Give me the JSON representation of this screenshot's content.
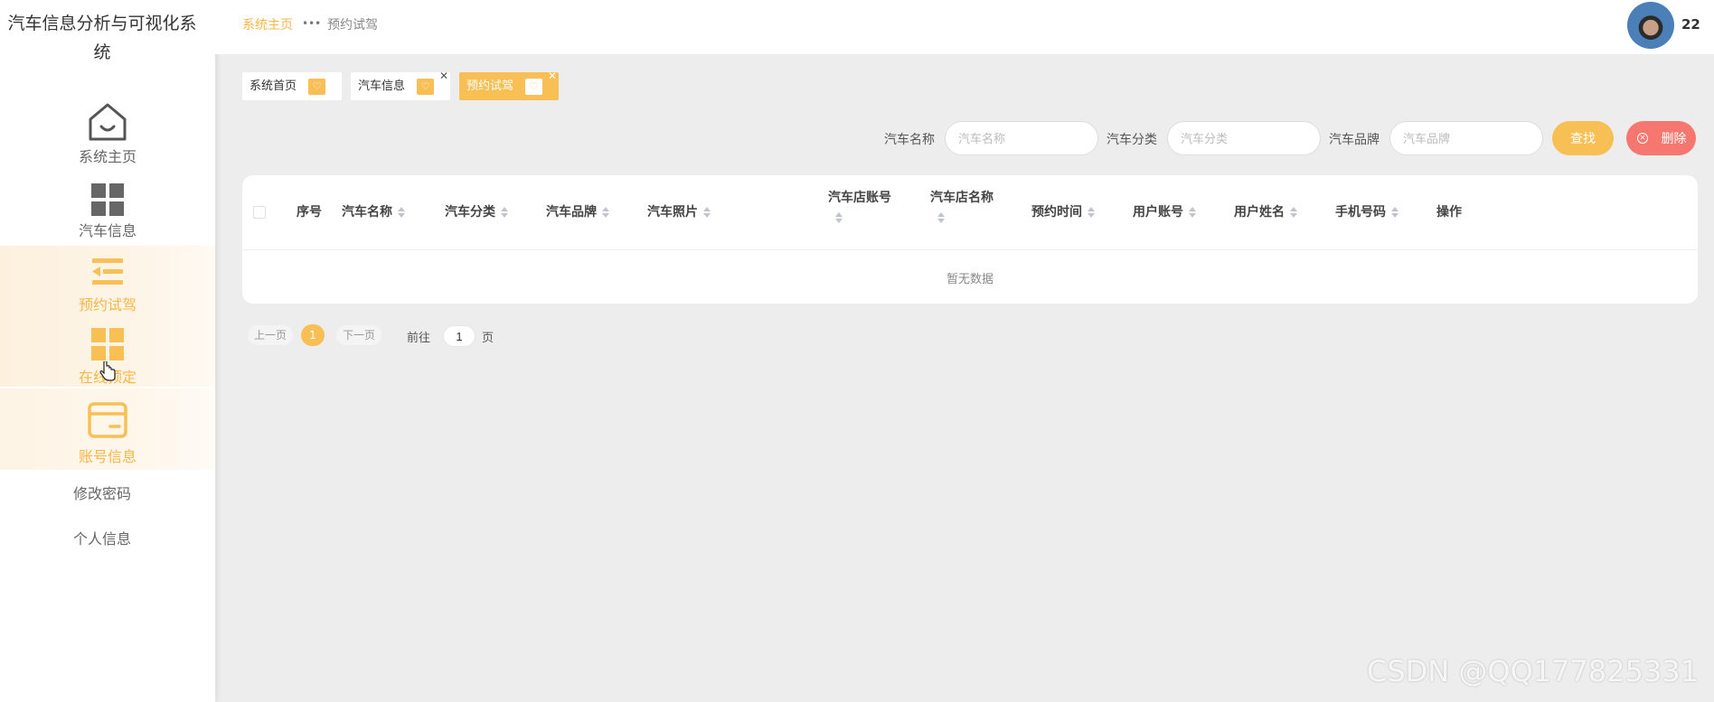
{
  "app": {
    "title": "汽车信息分析与可视化系统"
  },
  "sidebar": {
    "items": [
      {
        "label": "系统主页",
        "icon": "home-icon"
      },
      {
        "label": "汽车信息",
        "icon": "grid-icon"
      },
      {
        "label": "预约试驾",
        "icon": "list-icon"
      },
      {
        "label": "在线预定",
        "icon": "grid-icon"
      },
      {
        "label": "账号信息",
        "icon": "card-icon"
      },
      {
        "label": "修改密码"
      },
      {
        "label": "个人信息"
      }
    ]
  },
  "header": {
    "breadcrumb": {
      "home": "系统主页",
      "separator": "•••",
      "current": "预约试驾"
    },
    "username": "22"
  },
  "tabs": [
    {
      "label": "系统首页",
      "active": false,
      "closable": false
    },
    {
      "label": "汽车信息",
      "active": false,
      "closable": true
    },
    {
      "label": "预约试驾",
      "active": true,
      "closable": true
    }
  ],
  "search": {
    "fields": [
      {
        "label": "汽车名称",
        "placeholder": "汽车名称",
        "value": ""
      },
      {
        "label": "汽车分类",
        "placeholder": "汽车分类",
        "value": ""
      },
      {
        "label": "汽车品牌",
        "placeholder": "汽车品牌",
        "value": ""
      }
    ],
    "search_button": "查找",
    "delete_button": "删除"
  },
  "table": {
    "columns": [
      "序号",
      "汽车名称",
      "汽车分类",
      "汽车品牌",
      "汽车照片",
      "汽车店账号",
      "汽车店名称",
      "预约时间",
      "用户账号",
      "用户姓名",
      "手机号码",
      "操作"
    ],
    "rows": [],
    "empty_text": "暂无数据"
  },
  "pagination": {
    "prev": "上一页",
    "current_page": "1",
    "next": "下一页",
    "goto_prefix": "前往",
    "goto_value": "1",
    "goto_suffix": "页"
  },
  "watermark": "CSDN @QQ177825331",
  "colors": {
    "accent": "#f8bf55",
    "delete": "#f6776f",
    "active_text": "#f8b645"
  }
}
